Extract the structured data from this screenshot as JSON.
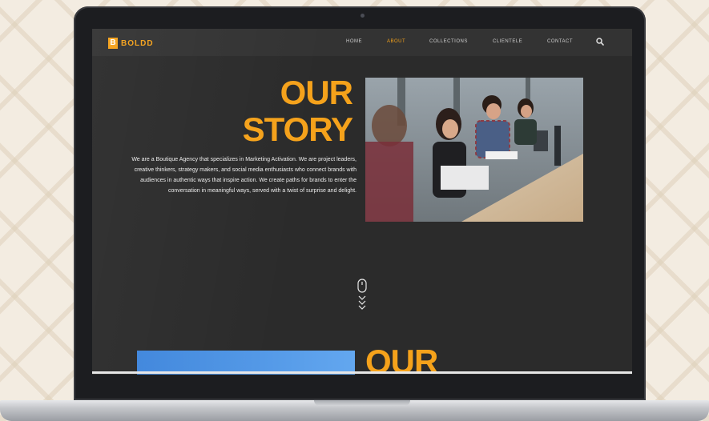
{
  "header": {
    "logo_mark": "B",
    "logo_text": "BOLDD",
    "nav": [
      {
        "label": "HOME"
      },
      {
        "label": "ABOUT"
      },
      {
        "label": "COLLECTIONS"
      },
      {
        "label": "CLIENTELE"
      },
      {
        "label": "CONTACT"
      }
    ]
  },
  "hero": {
    "title_line1": "OUR",
    "title_line2": "STORY",
    "body": "We are a Boutique Agency that specializes in Marketing Activation. We are project leaders, creative thinkers, strategy makers, and social media enthusiasts who connect brands with audiences in authentic ways that inspire action. We create paths for brands to enter the conversation in meaningful ways, served with a twist of surprise and delight."
  },
  "next_section": {
    "title": "OUR"
  },
  "colors": {
    "accent": "#f5a21b",
    "screen_bg": "#2b2b2b",
    "nav_bg": "#333333",
    "blue_block": "#4a90e2"
  },
  "icons": [
    "search-icon",
    "mouse-scroll-icon",
    "chevrons-down-icon"
  ]
}
